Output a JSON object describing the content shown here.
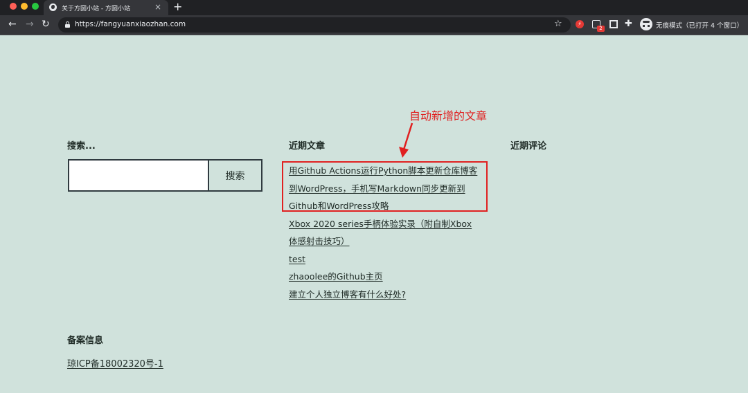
{
  "browser": {
    "tab_title": "关于方圆小站 - 方圆小站",
    "tab_close": "×",
    "new_tab": "+",
    "nav_back": "←",
    "nav_forward": "→",
    "nav_reload": "↻",
    "url": "https://fangyuanxiaozhan.com",
    "bookmark_star": "☆",
    "extension_badge": "2",
    "incognito_label": "无痕模式（已打开 4 个窗口）"
  },
  "search_widget": {
    "title": "搜索...",
    "input_value": "",
    "button_label": "搜索"
  },
  "recent_posts": {
    "title": "近期文章",
    "items": [
      "用Github Actions运行Python脚本更新仓库博客",
      "到WordPress，手机写Markdown同步更新到",
      "Github和WordPress攻略",
      "Xbox 2020 series手柄体验实录（附自制Xbox",
      "体感射击技巧）",
      "test",
      "zhaoolee的Github主页",
      "建立个人独立博客有什么好处?"
    ]
  },
  "recent_comments": {
    "title": "近期评论"
  },
  "annotation": {
    "text": "自动新增的文章",
    "color": "#e02020"
  },
  "footer": {
    "title": "备案信息",
    "icp": "琼ICP备18002320号-1"
  },
  "colors": {
    "page_background": "#d0e2dc",
    "text": "#1f2b26",
    "border": "#2f3a3f"
  }
}
